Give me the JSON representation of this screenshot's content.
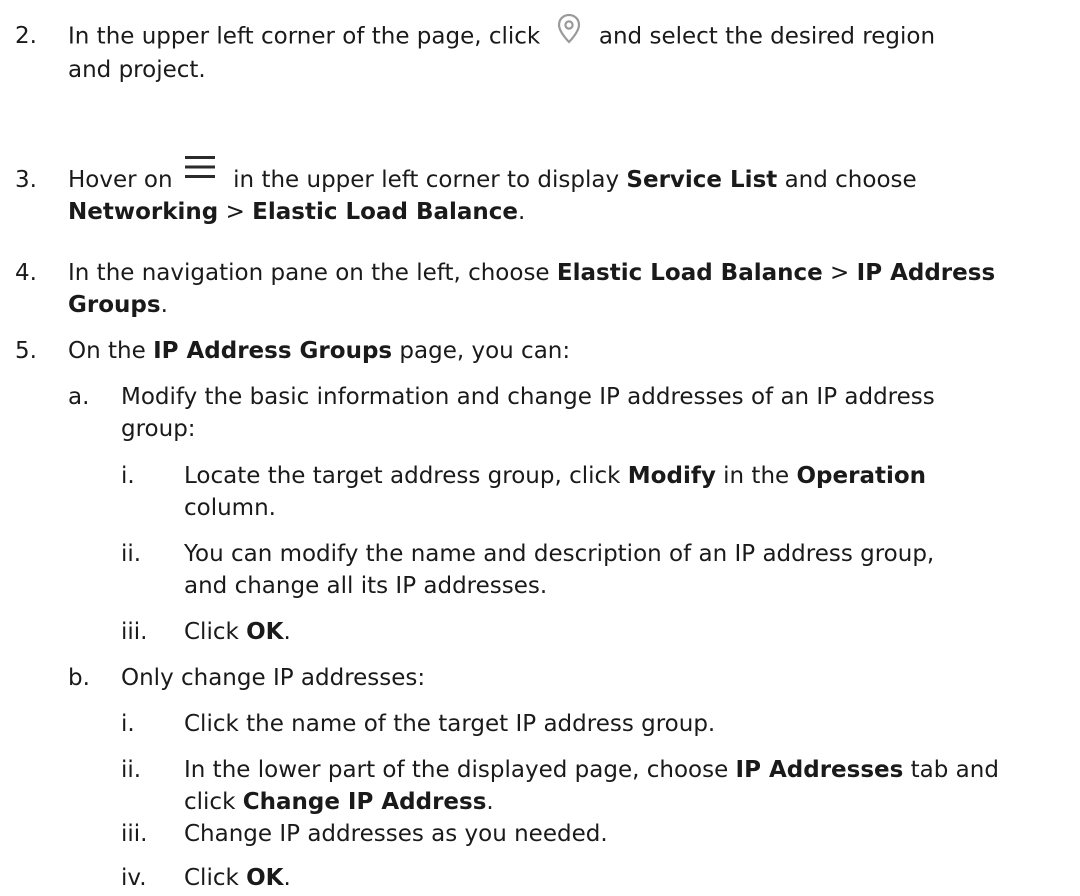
{
  "steps": [
    {
      "num": "2.",
      "pre": "In the upper left corner of the page, click ",
      "post": " and select the desired region",
      "line2": "and project."
    },
    {
      "num": "3.",
      "pre": "Hover on ",
      "mid": " in the upper left corner to display ",
      "b1": "Service List",
      "mid2": " and choose",
      "b2": "Networking",
      "gt": " > ",
      "b3": "Elastic Load Balance",
      "end": "."
    },
    {
      "num": "4.",
      "pre": "In the navigation pane on the left, choose ",
      "b1": "Elastic Load Balance",
      "gt": " > ",
      "b2a": "IP Address",
      "b2b": "Groups",
      "end": "."
    },
    {
      "num": "5.",
      "pre": "On the ",
      "b1": "IP Address Groups",
      "post": " page, you can:"
    }
  ],
  "sub_a": {
    "num": "a.",
    "line1": "Modify the basic information and change IP addresses of an IP address",
    "line2": "group:",
    "items": [
      {
        "num": "i.",
        "pre": "Locate the target address group, click ",
        "b1": "Modify",
        "mid": " in the ",
        "b2": "Operation",
        "line2": "column."
      },
      {
        "num": "ii.",
        "line1": "You can modify the name and description of an IP address group,",
        "line2": "and change all its IP addresses."
      },
      {
        "num": "iii.",
        "pre": "Click ",
        "b1": "OK",
        "end": "."
      }
    ]
  },
  "sub_b": {
    "num": "b.",
    "line1": "Only change IP addresses:",
    "items": [
      {
        "num": "i.",
        "text": "Click the name of the target IP address group."
      },
      {
        "num": "ii.",
        "pre": "In the lower part of the displayed page, choose ",
        "b1": "IP Addresses",
        "post": " tab and",
        "pre2": "click ",
        "b2": "Change IP Address",
        "end": "."
      },
      {
        "num": "iii.",
        "text": "Change IP addresses as you needed."
      },
      {
        "num": "iv.",
        "pre": "Click ",
        "b1": "OK",
        "end": "."
      }
    ]
  },
  "icons": {
    "location": "location-pin-icon",
    "menu": "hamburger-menu-icon"
  }
}
